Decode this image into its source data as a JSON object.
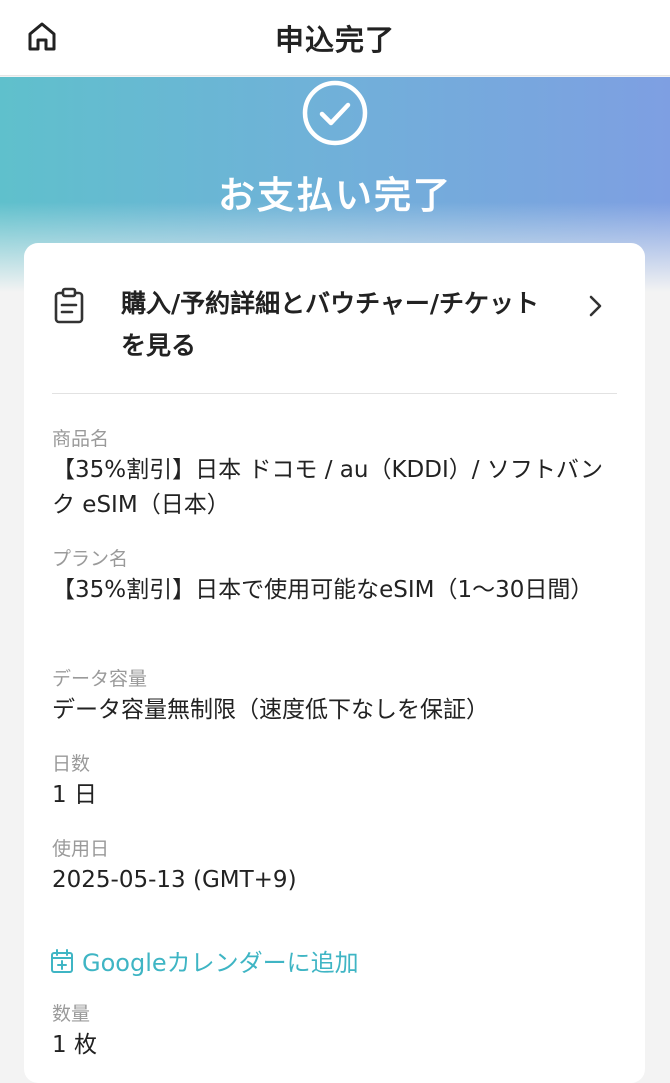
{
  "header": {
    "title": "申込完了"
  },
  "hero": {
    "title": "お支払い完了"
  },
  "card": {
    "detail_link": "購入/予約詳細とバウチャー/チケットを見る",
    "fields": [
      {
        "label": "商品名",
        "value": "【35%割引】日本 ドコモ / au（KDDI）/ ソフトバンク eSIM（日本）"
      },
      {
        "label": "プラン名",
        "value": "【35%割引】日本で使用可能なeSIM（1〜30日間）"
      },
      {
        "label": "データ容量",
        "value": "データ容量無制限（速度低下なしを保証）"
      },
      {
        "label": "日数",
        "value": "1 日"
      },
      {
        "label": "使用日",
        "value": "2025-05-13 (GMT+9)"
      }
    ],
    "calendar_link": "Googleカレンダーに追加",
    "quantity": {
      "label": "数量",
      "value": "1 枚"
    }
  },
  "colors": {
    "accent": "#3fb5c4",
    "hero_start": "#5fc0cc",
    "hero_end": "#7e9fe2"
  },
  "icons": [
    "home-icon",
    "check-circle-icon",
    "clipboard-icon",
    "chevron-right-icon",
    "calendar-add-icon"
  ]
}
